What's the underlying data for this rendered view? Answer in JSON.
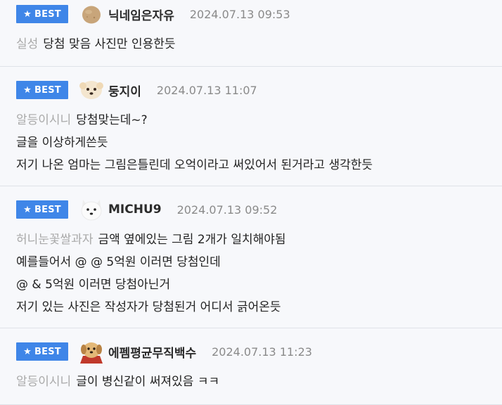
{
  "best_label": "BEST",
  "comments": [
    {
      "nickname": "닉네임은자유",
      "date": "2024.07.13 09:53",
      "mention": "실성",
      "lines": [
        "당첨 맞음 사진만 인용한듯"
      ],
      "avatar_icon": "potato-avatar-icon"
    },
    {
      "nickname": "둥지이",
      "date": "2024.07.13 11:07",
      "mention": "알등이시니",
      "lines": [
        "당첨맞는데~?",
        "글을 이상하게쓴듯",
        "저기 나온 엄마는 그림은틀린데 오억이라고 써있어서 된거라고 생각한듯"
      ],
      "avatar_icon": "puppy-avatar-icon"
    },
    {
      "nickname": "MICHU9",
      "date": "2024.07.13 09:52",
      "mention": "허니눈꽃쌀과자",
      "lines": [
        "금액 옆에있는 그림 2개가 일치해야됨",
        "예를들어서 @ @ 5억원 이러면 당첨인데",
        "@ & 5억원 이러면 당첨아닌거",
        "저기 있는 사진은 작성자가 당첨된거 어디서 긁어온듯"
      ],
      "avatar_icon": "white-dog-avatar-icon"
    },
    {
      "nickname": "에펨평균무직백수",
      "date": "2024.07.13 11:23",
      "mention": "알등이시니",
      "lines": [
        "글이 병신같이 써져있음 ㅋㅋ"
      ],
      "avatar_icon": "caped-puppy-avatar-icon"
    }
  ],
  "colors": {
    "best_badge": "#3f86e8",
    "mention": "#a9a9a9",
    "date": "#8a8a8a",
    "background": "#f7f8fb"
  }
}
